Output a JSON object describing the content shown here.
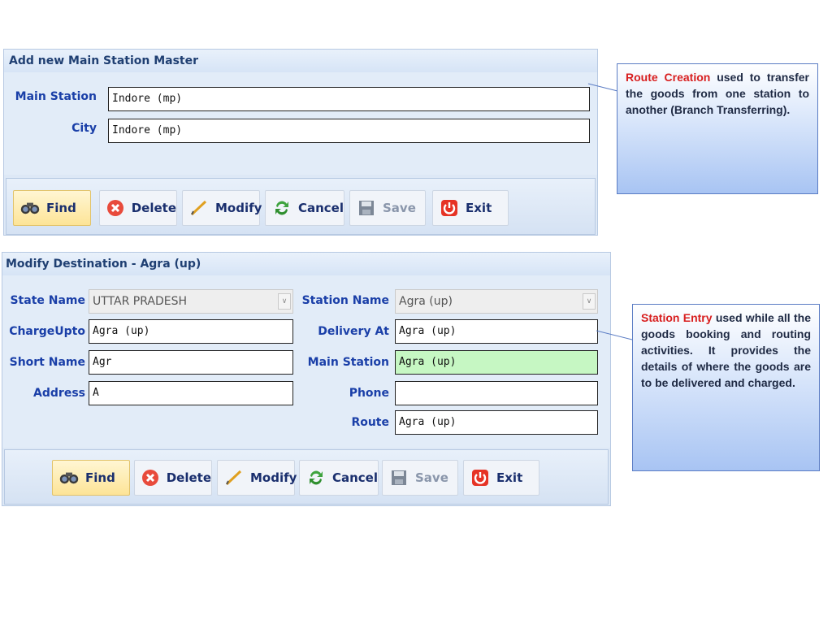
{
  "panel1": {
    "title": "Add new Main Station Master",
    "main_station_label": "Main Station",
    "main_station_value": "Indore (mp)",
    "city_label": "City",
    "city_value": "Indore (mp)"
  },
  "panel2": {
    "title": "Modify Destination - Agra (up)",
    "state_name_label": "State Name",
    "state_name_value": "UTTAR PRADESH",
    "station_name_label": "Station Name",
    "station_name_value": "Agra (up)",
    "chargeupto_label": "ChargeUpto",
    "chargeupto_value": "Agra (up)",
    "delivery_at_label": "Delivery At",
    "delivery_at_value": "Agra (up)",
    "short_name_label": "Short Name",
    "short_name_value": "Agr",
    "main_station_label": "Main Station",
    "main_station_value": "Agra (up)",
    "address_label": "Address",
    "address_value": "A",
    "phone_label": "Phone",
    "phone_value": "",
    "route_label": "Route",
    "route_value": "Agra (up)"
  },
  "toolbar": {
    "find": "Find",
    "delete": "Delete",
    "modify": "Modify",
    "cancel": "Cancel",
    "save": "Save",
    "exit": "Exit"
  },
  "callout1": {
    "highlight": "Route Creation",
    "text": " used to transfer the goods from one station to another (Branch Transferring)."
  },
  "callout2": {
    "highlight": "Station Entry",
    "text": " used while all the goods booking and routing activities. It provides the details of where the goods are to be delivered and charged."
  },
  "colors": {
    "label_blue": "#1a3fa8",
    "highlight_red": "#d81e1e",
    "field_green": "#c6f7c3"
  }
}
